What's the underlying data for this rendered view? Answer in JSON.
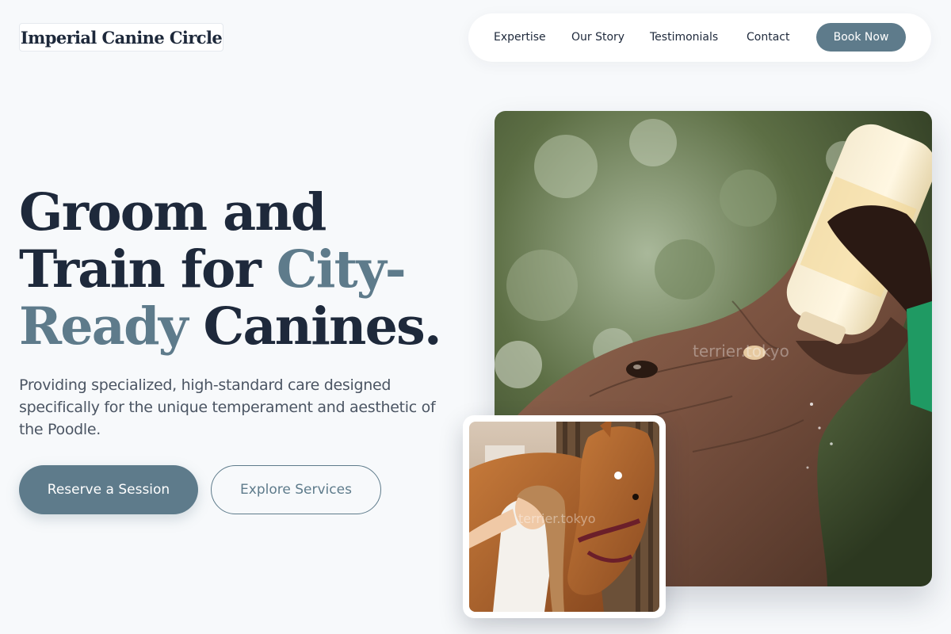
{
  "header": {
    "logo": "Imperial Canine Circle",
    "nav": [
      "Expertise",
      "Our Story",
      "Testimonials",
      "Contact"
    ],
    "cta": "Book Now"
  },
  "hero": {
    "title_line1": "Groom and",
    "title_line2_a": "Train for ",
    "title_line2_b": "City-",
    "title_line3_a": "Ready",
    "title_line3_b": " Canines.",
    "subtitle": "Providing specialized, high-standard care designed specifically for the unique temperament and aesthetic of the Poodle.",
    "primary_button": "Reserve a Session",
    "secondary_button": "Explore Services"
  },
  "images": {
    "main_watermark": "terrier.tokyo",
    "inset_watermark": "terrier.tokyo"
  },
  "colors": {
    "accent": "#5e7b8b",
    "heading": "#1e293b",
    "background": "#f7f9fb"
  }
}
